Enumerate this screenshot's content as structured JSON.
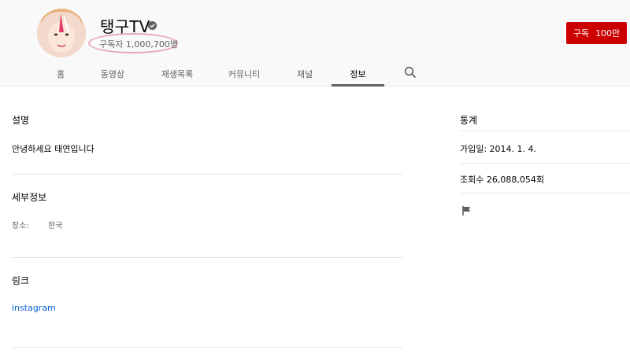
{
  "channel": {
    "name": "탱구TV",
    "subscribers": "구독자 1,000,700명"
  },
  "subscribe_button": {
    "label": "구독",
    "count": "100만"
  },
  "tabs": [
    {
      "label": "홈"
    },
    {
      "label": "동영상"
    },
    {
      "label": "재생목록"
    },
    {
      "label": "커뮤니티"
    },
    {
      "label": "채널"
    },
    {
      "label": "정보",
      "active": true
    }
  ],
  "about": {
    "description_title": "설명",
    "description": "안녕하세요 태연입니다",
    "details_title": "세부정보",
    "location_label": "장소:",
    "location_value": "한국",
    "links_title": "링크",
    "links": [
      {
        "label": "instagram"
      }
    ]
  },
  "stats": {
    "title": "통계",
    "joined": "가입일: 2014. 1. 4.",
    "views": "조회수 26,088,054회"
  },
  "icons": [
    "verified-icon",
    "search-icon",
    "flag-icon"
  ],
  "colors": {
    "subscribe": "#cc0000",
    "link": "#065fd4",
    "highlight_oval": "#e8a7c0"
  }
}
